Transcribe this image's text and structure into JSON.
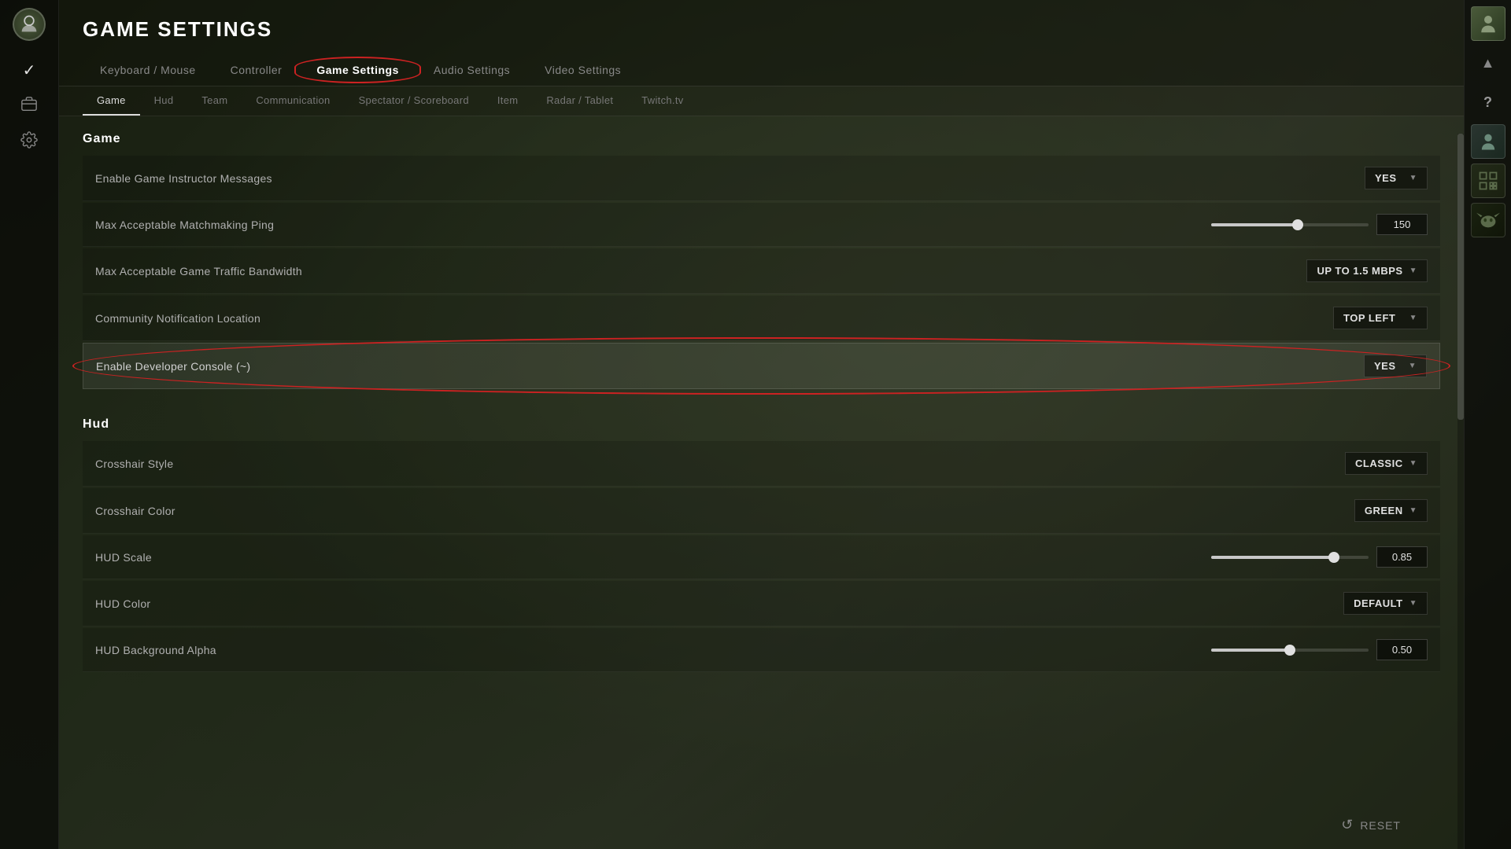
{
  "app": {
    "title": "GAME SETTINGS"
  },
  "top_nav": {
    "items": [
      {
        "id": "keyboard-mouse",
        "label": "Keyboard / Mouse",
        "active": false
      },
      {
        "id": "controller",
        "label": "Controller",
        "active": false
      },
      {
        "id": "game-settings",
        "label": "Game Settings",
        "active": true
      },
      {
        "id": "audio-settings",
        "label": "Audio Settings",
        "active": false
      },
      {
        "id": "video-settings",
        "label": "Video Settings",
        "active": false
      }
    ]
  },
  "sub_nav": {
    "items": [
      {
        "id": "game",
        "label": "Game",
        "active": true
      },
      {
        "id": "hud",
        "label": "Hud",
        "active": false
      },
      {
        "id": "team",
        "label": "Team",
        "active": false
      },
      {
        "id": "communication",
        "label": "Communication",
        "active": false
      },
      {
        "id": "spectator-scoreboard",
        "label": "Spectator / Scoreboard",
        "active": false
      },
      {
        "id": "item",
        "label": "Item",
        "active": false
      },
      {
        "id": "radar-tablet",
        "label": "Radar / Tablet",
        "active": false
      },
      {
        "id": "twitchtv",
        "label": "Twitch.tv",
        "active": false
      }
    ]
  },
  "sections": {
    "game": {
      "title": "Game",
      "settings": [
        {
          "id": "enable-game-instructor",
          "label": "Enable Game Instructor Messages",
          "type": "dropdown",
          "value": "YES",
          "highlighted": false
        },
        {
          "id": "max-matchmaking-ping",
          "label": "Max Acceptable Matchmaking Ping",
          "type": "slider-input",
          "slider_percent": 55,
          "value": "150",
          "highlighted": false
        },
        {
          "id": "max-game-traffic",
          "label": "Max Acceptable Game Traffic Bandwidth",
          "type": "dropdown",
          "value": "UP TO 1.5 MBPS",
          "highlighted": false
        },
        {
          "id": "community-notification-location",
          "label": "Community Notification Location",
          "type": "dropdown",
          "value": "TOP LEFT",
          "highlighted": false
        },
        {
          "id": "enable-developer-console",
          "label": "Enable Developer Console (~)",
          "type": "dropdown",
          "value": "YES",
          "highlighted": true
        }
      ]
    },
    "hud": {
      "title": "Hud",
      "settings": [
        {
          "id": "crosshair-style",
          "label": "Crosshair Style",
          "type": "dropdown",
          "value": "CLASSIC",
          "highlighted": false
        },
        {
          "id": "crosshair-color",
          "label": "Crosshair Color",
          "type": "dropdown",
          "value": "GREEN",
          "highlighted": false
        },
        {
          "id": "hud-scale",
          "label": "HUD Scale",
          "type": "slider-input",
          "slider_percent": 78,
          "value": "0.85",
          "highlighted": false
        },
        {
          "id": "hud-color",
          "label": "HUD Color",
          "type": "dropdown",
          "value": "DEFAULT",
          "highlighted": false
        },
        {
          "id": "hud-background-alpha",
          "label": "HUD Background Alpha",
          "type": "slider-input",
          "slider_percent": 50,
          "value": "0.50",
          "highlighted": false
        }
      ]
    }
  },
  "reset_btn": {
    "label": "RESET",
    "icon": "↺"
  },
  "sidebar": {
    "icons": [
      {
        "id": "logo",
        "symbol": "⊙"
      },
      {
        "id": "check",
        "symbol": "✓"
      },
      {
        "id": "briefcase",
        "symbol": "⊞"
      },
      {
        "id": "settings",
        "symbol": "⚙"
      }
    ]
  },
  "right_sidebar": {
    "items": [
      {
        "id": "avatar-main",
        "type": "avatar",
        "color": "#3a4a2a"
      },
      {
        "id": "up-chevron",
        "type": "icon",
        "symbol": "▲"
      },
      {
        "id": "question",
        "type": "icon",
        "symbol": "?"
      },
      {
        "id": "avatar-person",
        "type": "avatar",
        "color": "#2a3530"
      },
      {
        "id": "avatar-qr",
        "type": "avatar",
        "color": "#222a18"
      },
      {
        "id": "avatar-batman",
        "type": "avatar",
        "color": "#1a2210"
      }
    ]
  },
  "colors": {
    "accent_red": "#cc2222",
    "bg_dark": "#0a0c08",
    "text_primary": "#ffffff",
    "text_secondary": "#b0b0b0",
    "text_muted": "#777777"
  }
}
